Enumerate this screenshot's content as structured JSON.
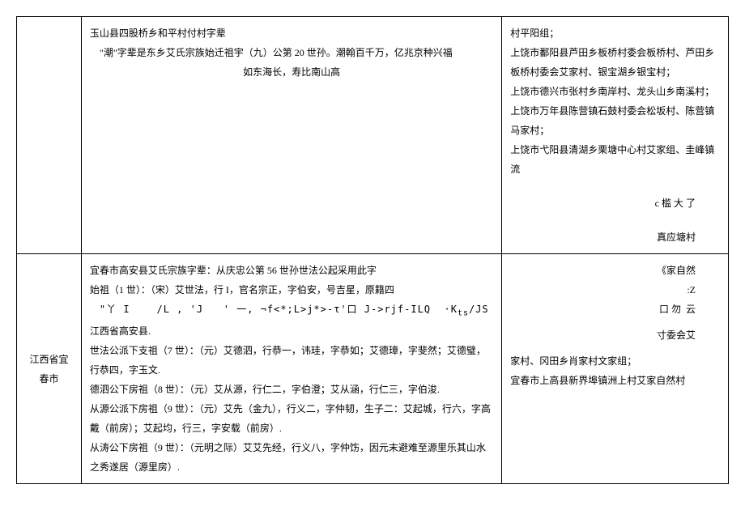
{
  "rows": [
    {
      "col1": "",
      "col2_lines": [
        {
          "text": "玉山县四股桥乡和平村付村字辈",
          "cls": ""
        },
        {
          "text": "\"潮\"字辈是东乡艾氏宗族始迁祖宇（九）公第 20 世孙。潮翰百千万，亿兆京种兴福",
          "cls": "indent"
        },
        {
          "text": "如东海长，寿比南山高",
          "cls": "center-line"
        }
      ],
      "col3_lines": [
        {
          "text": "村平阳组；",
          "cls": ""
        },
        {
          "text": "上饶市鄱阳县芦田乡板桥村委会板桥村、芦田乡板桥村委会艾家村、银宝湖乡银宝村；",
          "cls": ""
        },
        {
          "text": "上饶市德兴市张村乡南岸村、龙头山乡南溪村；",
          "cls": ""
        },
        {
          "text": "上饶市万年县陈营镇石鼓村委会松坂村、陈营镇马家村；",
          "cls": ""
        },
        {
          "text": "上饶市弋阳县清湖乡栗塘中心村艾家组、圭峰镇流",
          "cls": ""
        },
        {
          "text": "",
          "cls": "gap"
        },
        {
          "text": "c 槛 大 了",
          "cls": "right-frag"
        },
        {
          "text": "",
          "cls": "gap"
        },
        {
          "text": "真应塘村",
          "cls": "right-frag"
        }
      ]
    },
    {
      "col1": "江西省宜春市",
      "col2_lines": [
        {
          "text": "宜春市高安县艾氏宗族字辈：从庆忠公第 56 世孙世法公起采用此字",
          "cls": ""
        },
        {
          "text": "始祖（1 世）：（宋）艾世法，行 I，官名宗正，字伯安，号吉星，原籍四",
          "cls": ""
        },
        {
          "text": "\"丫 I&nbsp;&nbsp;&nbsp;&nbsp;/L , 'J&nbsp;&nbsp;&nbsp;' 一, ¬f<*;L>j*>-τ'口 J->rjf-ILQ&nbsp;&nbsp;·K<sub>ts</sub>/JS",
          "cls": "indent garbled"
        },
        {
          "text": "江西省高安县.",
          "cls": ""
        },
        {
          "text": "世法公派下支祖（7 世）：（元）艾德泗，行恭一，讳珪，字恭如；艾德璋，字斐然；艾德璧，行恭四，字玉文.",
          "cls": ""
        },
        {
          "text": "德泗公下房祖（8 世）：（元）艾从源，行仁二，字伯澄；艾从涵，行仁三，字伯浚.",
          "cls": ""
        },
        {
          "text": "从源公派下房祖（9 世）：（元）艾先（金九），行义二，字仲韧，生子二：艾起城，行六，字高戴（前房）；艾起均，行三，字安载（前房）.",
          "cls": ""
        },
        {
          "text": "从涛公下房祖（9 世）：（元明之际）艾艾先经，行义八，字仲饬，因元末避难至源里乐其山水之秀遂居（源里房）.",
          "cls": ""
        }
      ],
      "col3_lines": [
        {
          "text": "《家自然",
          "cls": "right-frag"
        },
        {
          "text": ":Z",
          "cls": "right-frag"
        },
        {
          "text": "口 勿&nbsp;&nbsp;云",
          "cls": "right-frag"
        },
        {
          "text": "",
          "cls": "small-gap"
        },
        {
          "text": "寸委会艾",
          "cls": "right-frag"
        },
        {
          "text": "",
          "cls": "small-gap"
        },
        {
          "text": "家村、冈田乡肖家村文家组；",
          "cls": ""
        },
        {
          "text": "宜春市上高县新界埠镇洲上村艾家自然村",
          "cls": ""
        }
      ]
    }
  ]
}
